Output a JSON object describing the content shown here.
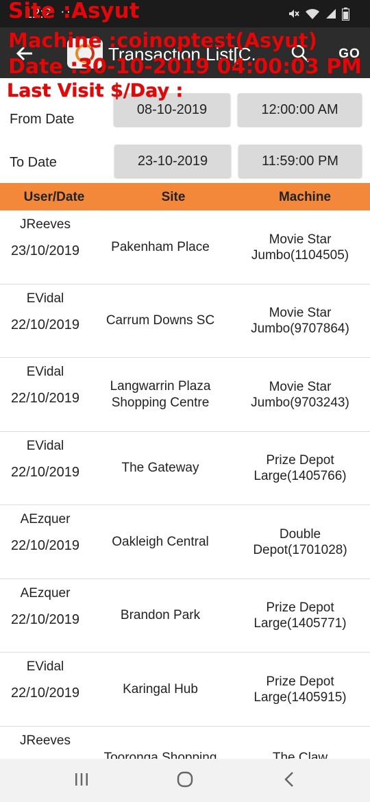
{
  "status_bar": {
    "time": "12:2",
    "notification_dots": "···",
    "icons": [
      "mute-icon",
      "wifi-icon",
      "signal-icon",
      "battery-icon"
    ]
  },
  "app_bar": {
    "title": "Transaction List[C...",
    "go_label": "GO",
    "icons": [
      "back-arrow-icon",
      "app-logo",
      "search-icon"
    ]
  },
  "overlay": {
    "site": "Site :Asyut",
    "machine": "Machine :coinoptest(Asyut)",
    "date": "Date :30-10-2019 04:00:03 PM",
    "last_visit": "Last Visit $/Day :",
    "color": "#e00808"
  },
  "filters": {
    "from": {
      "label": "From Date",
      "date": "08-10-2019",
      "time": "12:00:00 AM"
    },
    "to": {
      "label": "To Date",
      "date": "23-10-2019",
      "time": "11:59:00 PM"
    }
  },
  "table": {
    "header_color": "#f4883a",
    "columns": [
      "User/Date",
      "Site",
      "Machine"
    ],
    "rows": [
      {
        "user": "JReeves",
        "date": "23/10/2019",
        "site": "Pakenham Place",
        "machine": "Movie Star Jumbo(1104505)"
      },
      {
        "user": "EVidal",
        "date": "22/10/2019",
        "site": "Carrum Downs SC",
        "machine": "Movie Star Jumbo(9707864)"
      },
      {
        "user": "EVidal",
        "date": "22/10/2019",
        "site": "Langwarrin Plaza Shopping Centre",
        "machine": "Movie Star Jumbo(9703243)"
      },
      {
        "user": "EVidal",
        "date": "22/10/2019",
        "site": "The Gateway",
        "machine": "Prize Depot Large(1405766)"
      },
      {
        "user": "AEzquer",
        "date": "22/10/2019",
        "site": "Oakleigh Central",
        "machine": "Double Depot(1701028)"
      },
      {
        "user": "AEzquer",
        "date": "22/10/2019",
        "site": "Brandon Park",
        "machine": "Prize Depot Large(1405771)"
      },
      {
        "user": "EVidal",
        "date": "22/10/2019",
        "site": "Karingal Hub",
        "machine": "Prize Depot Large(1405915)"
      },
      {
        "user": "JReeves",
        "date": "",
        "site": "Tooronga Shopping",
        "machine": "The Claw"
      }
    ]
  },
  "nav_bar": {
    "icons": [
      "recents-icon",
      "home-icon",
      "back-icon"
    ]
  }
}
